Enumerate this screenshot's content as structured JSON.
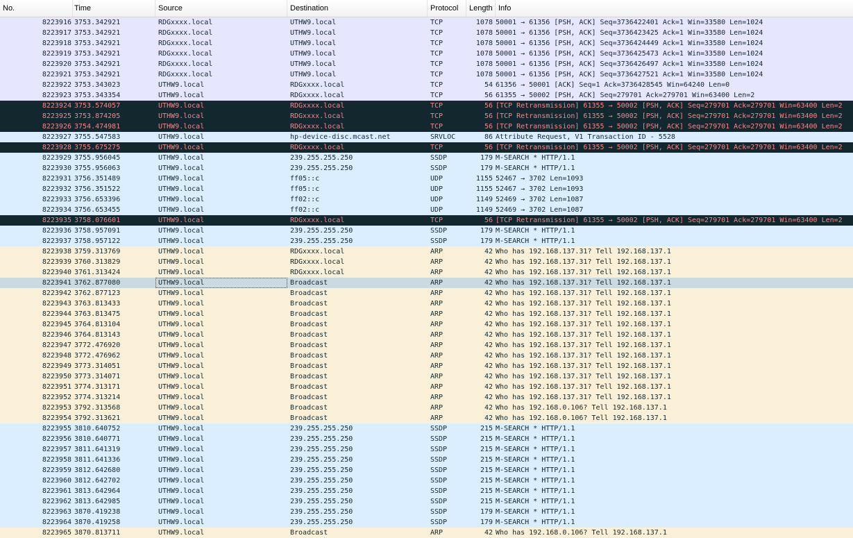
{
  "columns": [
    "No.",
    "Time",
    "Source",
    "Destination",
    "Protocol",
    "Length",
    "Info"
  ],
  "colors": {
    "tcp": "#e7e6ff",
    "retransmission_bg": "#12272e",
    "retransmission_fg": "#f78787",
    "udp": "#daeeff",
    "arp": "#faf0d7",
    "selected": "#cadae0"
  },
  "rows": [
    {
      "no": "8223916",
      "time": "3753.342921",
      "src": "RDGxxxx.local",
      "dst": "UTHW9.local",
      "proto": "TCP",
      "len": "1078",
      "info": "50001 → 61356 [PSH, ACK] Seq=3736422401 Ack=1 Win=33580 Len=1024",
      "cls": "tcp"
    },
    {
      "no": "8223917",
      "time": "3753.342921",
      "src": "RDGxxxx.local",
      "dst": "UTHW9.local",
      "proto": "TCP",
      "len": "1078",
      "info": "50001 → 61356 [PSH, ACK] Seq=3736423425 Ack=1 Win=33580 Len=1024",
      "cls": "tcp"
    },
    {
      "no": "8223918",
      "time": "3753.342921",
      "src": "RDGxxxx.local",
      "dst": "UTHW9.local",
      "proto": "TCP",
      "len": "1078",
      "info": "50001 → 61356 [PSH, ACK] Seq=3736424449 Ack=1 Win=33580 Len=1024",
      "cls": "tcp"
    },
    {
      "no": "8223919",
      "time": "3753.342921",
      "src": "RDGxxxx.local",
      "dst": "UTHW9.local",
      "proto": "TCP",
      "len": "1078",
      "info": "50001 → 61356 [PSH, ACK] Seq=3736425473 Ack=1 Win=33580 Len=1024",
      "cls": "tcp"
    },
    {
      "no": "8223920",
      "time": "3753.342921",
      "src": "RDGxxxx.local",
      "dst": "UTHW9.local",
      "proto": "TCP",
      "len": "1078",
      "info": "50001 → 61356 [PSH, ACK] Seq=3736426497 Ack=1 Win=33580 Len=1024",
      "cls": "tcp"
    },
    {
      "no": "8223921",
      "time": "3753.342921",
      "src": "RDGxxxx.local",
      "dst": "UTHW9.local",
      "proto": "TCP",
      "len": "1078",
      "info": "50001 → 61356 [PSH, ACK] Seq=3736427521 Ack=1 Win=33580 Len=1024",
      "cls": "tcp"
    },
    {
      "no": "8223922",
      "time": "3753.343023",
      "src": "UTHW9.local",
      "dst": "RDGxxxx.local",
      "proto": "TCP",
      "len": "54",
      "info": "61356 → 50001 [ACK] Seq=1 Ack=3736428545 Win=64240 Len=0",
      "cls": "tcp"
    },
    {
      "no": "8223923",
      "time": "3753.343354",
      "src": "UTHW9.local",
      "dst": "RDGxxxx.local",
      "proto": "TCP",
      "len": "56",
      "info": "61355 → 50002 [PSH, ACK] Seq=279701 Ack=279701 Win=63400 Len=2",
      "cls": "tcp"
    },
    {
      "no": "8223924",
      "time": "3753.574057",
      "src": "UTHW9.local",
      "dst": "RDGxxxx.local",
      "proto": "TCP",
      "len": "56",
      "info": "[TCP Retransmission] 61355 → 50002 [PSH, ACK] Seq=279701 Ack=279701 Win=63400 Len=2",
      "cls": "retx"
    },
    {
      "no": "8223925",
      "time": "3753.874205",
      "src": "UTHW9.local",
      "dst": "RDGxxxx.local",
      "proto": "TCP",
      "len": "56",
      "info": "[TCP Retransmission] 61355 → 50002 [PSH, ACK] Seq=279701 Ack=279701 Win=63400 Len=2",
      "cls": "retx"
    },
    {
      "no": "8223926",
      "time": "3754.474981",
      "src": "UTHW9.local",
      "dst": "RDGxxxx.local",
      "proto": "TCP",
      "len": "56",
      "info": "[TCP Retransmission] 61355 → 50002 [PSH, ACK] Seq=279701 Ack=279701 Win=63400 Len=2",
      "cls": "retx"
    },
    {
      "no": "8223927",
      "time": "3755.547583",
      "src": "UTHW9.local",
      "dst": "hp-device-disc.mcast.net",
      "proto": "SRVLOC",
      "len": "86",
      "info": "Attribute Request, V1 Transaction ID - 5528",
      "cls": "srv"
    },
    {
      "no": "8223928",
      "time": "3755.675275",
      "src": "UTHW9.local",
      "dst": "RDGxxxx.local",
      "proto": "TCP",
      "len": "56",
      "info": "[TCP Retransmission] 61355 → 50002 [PSH, ACK] Seq=279701 Ack=279701 Win=63400 Len=2",
      "cls": "retx"
    },
    {
      "no": "8223929",
      "time": "3755.956045",
      "src": "UTHW9.local",
      "dst": "239.255.255.250",
      "proto": "SSDP",
      "len": "179",
      "info": "M-SEARCH * HTTP/1.1",
      "cls": "ssdp"
    },
    {
      "no": "8223930",
      "time": "3755.956063",
      "src": "UTHW9.local",
      "dst": "239.255.255.250",
      "proto": "SSDP",
      "len": "179",
      "info": "M-SEARCH * HTTP/1.1",
      "cls": "ssdp"
    },
    {
      "no": "8223931",
      "time": "3756.351489",
      "src": "UTHW9.local",
      "dst": "ff05::c",
      "proto": "UDP",
      "len": "1155",
      "info": "52467 → 3702 Len=1093",
      "cls": "udp"
    },
    {
      "no": "8223932",
      "time": "3756.351522",
      "src": "UTHW9.local",
      "dst": "ff05::c",
      "proto": "UDP",
      "len": "1155",
      "info": "52467 → 3702 Len=1093",
      "cls": "udp"
    },
    {
      "no": "8223933",
      "time": "3756.653396",
      "src": "UTHW9.local",
      "dst": "ff02::c",
      "proto": "UDP",
      "len": "1149",
      "info": "52469 → 3702 Len=1087",
      "cls": "udp"
    },
    {
      "no": "8223934",
      "time": "3756.653455",
      "src": "UTHW9.local",
      "dst": "ff02::c",
      "proto": "UDP",
      "len": "1149",
      "info": "52469 → 3702 Len=1087",
      "cls": "udp"
    },
    {
      "no": "8223935",
      "time": "3758.076601",
      "src": "UTHW9.local",
      "dst": "RDGxxxx.local",
      "proto": "TCP",
      "len": "56",
      "info": "[TCP Retransmission] 61355 → 50002 [PSH, ACK] Seq=279701 Ack=279701 Win=63400 Len=2",
      "cls": "retx"
    },
    {
      "no": "8223936",
      "time": "3758.957091",
      "src": "UTHW9.local",
      "dst": "239.255.255.250",
      "proto": "SSDP",
      "len": "179",
      "info": "M-SEARCH * HTTP/1.1",
      "cls": "ssdp"
    },
    {
      "no": "8223937",
      "time": "3758.957122",
      "src": "UTHW9.local",
      "dst": "239.255.255.250",
      "proto": "SSDP",
      "len": "179",
      "info": "M-SEARCH * HTTP/1.1",
      "cls": "ssdp"
    },
    {
      "no": "8223938",
      "time": "3759.313769",
      "src": "UTHW9.local",
      "dst": "RDGxxxx.local",
      "proto": "ARP",
      "len": "42",
      "info": "Who has 192.168.137.31? Tell 192.168.137.1",
      "cls": "arp"
    },
    {
      "no": "8223939",
      "time": "3760.313829",
      "src": "UTHW9.local",
      "dst": "RDGxxxx.local",
      "proto": "ARP",
      "len": "42",
      "info": "Who has 192.168.137.31? Tell 192.168.137.1",
      "cls": "arp"
    },
    {
      "no": "8223940",
      "time": "3761.313424",
      "src": "UTHW9.local",
      "dst": "RDGxxxx.local",
      "proto": "ARP",
      "len": "42",
      "info": "Who has 192.168.137.31? Tell 192.168.137.1",
      "cls": "arp"
    },
    {
      "no": "8223941",
      "time": "3762.877080",
      "src": "UTHW9.local",
      "dst": "Broadcast",
      "proto": "ARP",
      "len": "42",
      "info": "Who has 192.168.137.31? Tell 192.168.137.1",
      "cls": "sel"
    },
    {
      "no": "8223942",
      "time": "3762.877123",
      "src": "UTHW9.local",
      "dst": "Broadcast",
      "proto": "ARP",
      "len": "42",
      "info": "Who has 192.168.137.31? Tell 192.168.137.1",
      "cls": "arp"
    },
    {
      "no": "8223943",
      "time": "3763.813433",
      "src": "UTHW9.local",
      "dst": "Broadcast",
      "proto": "ARP",
      "len": "42",
      "info": "Who has 192.168.137.31? Tell 192.168.137.1",
      "cls": "arp"
    },
    {
      "no": "8223944",
      "time": "3763.813475",
      "src": "UTHW9.local",
      "dst": "Broadcast",
      "proto": "ARP",
      "len": "42",
      "info": "Who has 192.168.137.31? Tell 192.168.137.1",
      "cls": "arp"
    },
    {
      "no": "8223945",
      "time": "3764.813104",
      "src": "UTHW9.local",
      "dst": "Broadcast",
      "proto": "ARP",
      "len": "42",
      "info": "Who has 192.168.137.31? Tell 192.168.137.1",
      "cls": "arp"
    },
    {
      "no": "8223946",
      "time": "3764.813143",
      "src": "UTHW9.local",
      "dst": "Broadcast",
      "proto": "ARP",
      "len": "42",
      "info": "Who has 192.168.137.31? Tell 192.168.137.1",
      "cls": "arp"
    },
    {
      "no": "8223947",
      "time": "3772.476920",
      "src": "UTHW9.local",
      "dst": "Broadcast",
      "proto": "ARP",
      "len": "42",
      "info": "Who has 192.168.137.31? Tell 192.168.137.1",
      "cls": "arp"
    },
    {
      "no": "8223948",
      "time": "3772.476962",
      "src": "UTHW9.local",
      "dst": "Broadcast",
      "proto": "ARP",
      "len": "42",
      "info": "Who has 192.168.137.31? Tell 192.168.137.1",
      "cls": "arp"
    },
    {
      "no": "8223949",
      "time": "3773.314051",
      "src": "UTHW9.local",
      "dst": "Broadcast",
      "proto": "ARP",
      "len": "42",
      "info": "Who has 192.168.137.31? Tell 192.168.137.1",
      "cls": "arp"
    },
    {
      "no": "8223950",
      "time": "3773.314071",
      "src": "UTHW9.local",
      "dst": "Broadcast",
      "proto": "ARP",
      "len": "42",
      "info": "Who has 192.168.137.31? Tell 192.168.137.1",
      "cls": "arp"
    },
    {
      "no": "8223951",
      "time": "3774.313171",
      "src": "UTHW9.local",
      "dst": "Broadcast",
      "proto": "ARP",
      "len": "42",
      "info": "Who has 192.168.137.31? Tell 192.168.137.1",
      "cls": "arp"
    },
    {
      "no": "8223952",
      "time": "3774.313214",
      "src": "UTHW9.local",
      "dst": "Broadcast",
      "proto": "ARP",
      "len": "42",
      "info": "Who has 192.168.137.31? Tell 192.168.137.1",
      "cls": "arp"
    },
    {
      "no": "8223953",
      "time": "3792.313568",
      "src": "UTHW9.local",
      "dst": "Broadcast",
      "proto": "ARP",
      "len": "42",
      "info": "Who has 192.168.0.106? Tell 192.168.137.1",
      "cls": "arp"
    },
    {
      "no": "8223954",
      "time": "3792.313621",
      "src": "UTHW9.local",
      "dst": "Broadcast",
      "proto": "ARP",
      "len": "42",
      "info": "Who has 192.168.0.106? Tell 192.168.137.1",
      "cls": "arp"
    },
    {
      "no": "8223955",
      "time": "3810.640752",
      "src": "UTHW9.local",
      "dst": "239.255.255.250",
      "proto": "SSDP",
      "len": "215",
      "info": "M-SEARCH * HTTP/1.1",
      "cls": "ssdp"
    },
    {
      "no": "8223956",
      "time": "3810.640771",
      "src": "UTHW9.local",
      "dst": "239.255.255.250",
      "proto": "SSDP",
      "len": "215",
      "info": "M-SEARCH * HTTP/1.1",
      "cls": "ssdp"
    },
    {
      "no": "8223957",
      "time": "3811.641319",
      "src": "UTHW9.local",
      "dst": "239.255.255.250",
      "proto": "SSDP",
      "len": "215",
      "info": "M-SEARCH * HTTP/1.1",
      "cls": "ssdp"
    },
    {
      "no": "8223958",
      "time": "3811.641336",
      "src": "UTHW9.local",
      "dst": "239.255.255.250",
      "proto": "SSDP",
      "len": "215",
      "info": "M-SEARCH * HTTP/1.1",
      "cls": "ssdp"
    },
    {
      "no": "8223959",
      "time": "3812.642680",
      "src": "UTHW9.local",
      "dst": "239.255.255.250",
      "proto": "SSDP",
      "len": "215",
      "info": "M-SEARCH * HTTP/1.1",
      "cls": "ssdp"
    },
    {
      "no": "8223960",
      "time": "3812.642702",
      "src": "UTHW9.local",
      "dst": "239.255.255.250",
      "proto": "SSDP",
      "len": "215",
      "info": "M-SEARCH * HTTP/1.1",
      "cls": "ssdp"
    },
    {
      "no": "8223961",
      "time": "3813.642964",
      "src": "UTHW9.local",
      "dst": "239.255.255.250",
      "proto": "SSDP",
      "len": "215",
      "info": "M-SEARCH * HTTP/1.1",
      "cls": "ssdp"
    },
    {
      "no": "8223962",
      "time": "3813.642985",
      "src": "UTHW9.local",
      "dst": "239.255.255.250",
      "proto": "SSDP",
      "len": "215",
      "info": "M-SEARCH * HTTP/1.1",
      "cls": "ssdp"
    },
    {
      "no": "8223963",
      "time": "3870.419238",
      "src": "UTHW9.local",
      "dst": "239.255.255.250",
      "proto": "SSDP",
      "len": "179",
      "info": "M-SEARCH * HTTP/1.1",
      "cls": "ssdp"
    },
    {
      "no": "8223964",
      "time": "3870.419258",
      "src": "UTHW9.local",
      "dst": "239.255.255.250",
      "proto": "SSDP",
      "len": "179",
      "info": "M-SEARCH * HTTP/1.1",
      "cls": "ssdp"
    },
    {
      "no": "8223965",
      "time": "3870.813711",
      "src": "UTHW9.local",
      "dst": "Broadcast",
      "proto": "ARP",
      "len": "42",
      "info": "Who has 192.168.0.106? Tell 192.168.137.1",
      "cls": "arp"
    }
  ]
}
